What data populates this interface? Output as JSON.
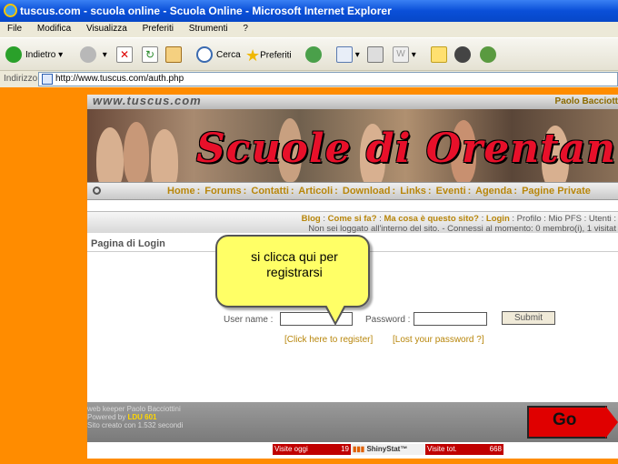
{
  "window": {
    "title": "tuscus.com - scuola online - Scuola Online - Microsoft Internet Explorer"
  },
  "menu": [
    "File",
    "Modifica",
    "Visualizza",
    "Preferiti",
    "Strumenti",
    "?"
  ],
  "toolbar": {
    "back_label": "Indietro",
    "search_label": "Cerca",
    "favorites_label": "Preferiti"
  },
  "address": {
    "label": "Indirizzo",
    "url": "http://www.tuscus.com/auth.php"
  },
  "site": {
    "logo_text": "www.tuscus.com",
    "admin_name": "Paolo Bacciott",
    "banner_title": "Scuole di Orentan",
    "nav": [
      "Home",
      "Forums",
      "Contatti",
      "Articoli",
      "Download",
      "Links",
      "Eventi",
      "Agenda",
      "Pagine Private"
    ],
    "nav_sep": ":",
    "sub_links": [
      "Blog",
      "Come si fa?",
      "Ma cosa è questo sito?",
      "Login",
      "Profilo",
      "Mio PFS",
      "Utenti"
    ],
    "status": "Non sei loggato all'interno del sito. - Connessi al momento: 0 membro(i), 1 visitat"
  },
  "login": {
    "title": "Pagina di Login",
    "user_label": "User name :",
    "pwd_label": "Password :",
    "submit": "Submit",
    "register_link": "[Click here to register]",
    "lost_link": "[Lost your password ?]"
  },
  "footer": {
    "line1": "web keeper Paolo Bacciottini",
    "line2_prefix": "Powered by",
    "line2_ldu": "LDU 601",
    "line3": "Sito creato con 1.532 secondi",
    "go": "Go"
  },
  "counter": {
    "left_label": "Visite oggi",
    "left_value": "19",
    "mid": "ShinyStat™",
    "right_label": "Visite tot.",
    "right_value": "668"
  },
  "callout": {
    "text": "si clicca qui per registrarsi"
  }
}
